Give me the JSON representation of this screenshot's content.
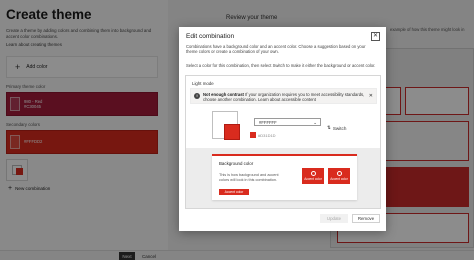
{
  "page": {
    "title": "Create theme",
    "description": "Create a theme by adding colors and combining them into background and accent color combinations.",
    "learn_link": "Learn about creating themes",
    "add_color": "Add color",
    "primary_label": "Primary theme color",
    "primary_swatch": {
      "name": "980 - Red",
      "hex": "#C30045"
    },
    "secondary_label": "Secondary colors",
    "secondary_swatch": {
      "hex": "#FFFDD2"
    },
    "new_combination": "New combination"
  },
  "review": {
    "title": "Review your theme",
    "desc": "example of how this theme might look in"
  },
  "footer": {
    "next": "Next",
    "cancel": "Cancel"
  },
  "dialog": {
    "title": "Edit combination",
    "description": "Combinations have a background color and an accent color. Choose a suggestion based on your theme colors or create a combination of your own.",
    "instruction": "Select a color for this combination, then select Switch to make it either the background or accent color.",
    "mode_title": "Light mode",
    "warning_bold": "Not enough contrast",
    "warning_text": "If your organization requires you to meet accessibility standards, choose another combination.",
    "warning_link": "Learn about accessible content",
    "background_hex": "#FFFFFF",
    "accent_hex": "#D31D1D",
    "switch_label": "Switch",
    "preview_title": "Background color",
    "preview_desc": "This is how background and accent colors will look in this combination.",
    "preview_button": "Accent color",
    "tile_label": "Accent color",
    "update_button": "Update",
    "remove_button": "Remove"
  },
  "colors": {
    "accent": "#D92B1E",
    "primary_dark": "#A51C3B"
  },
  "icons": [
    "plus-icon",
    "close-icon",
    "info-icon",
    "switch-icon",
    "globe-icon",
    "chevron-down-icon"
  ]
}
